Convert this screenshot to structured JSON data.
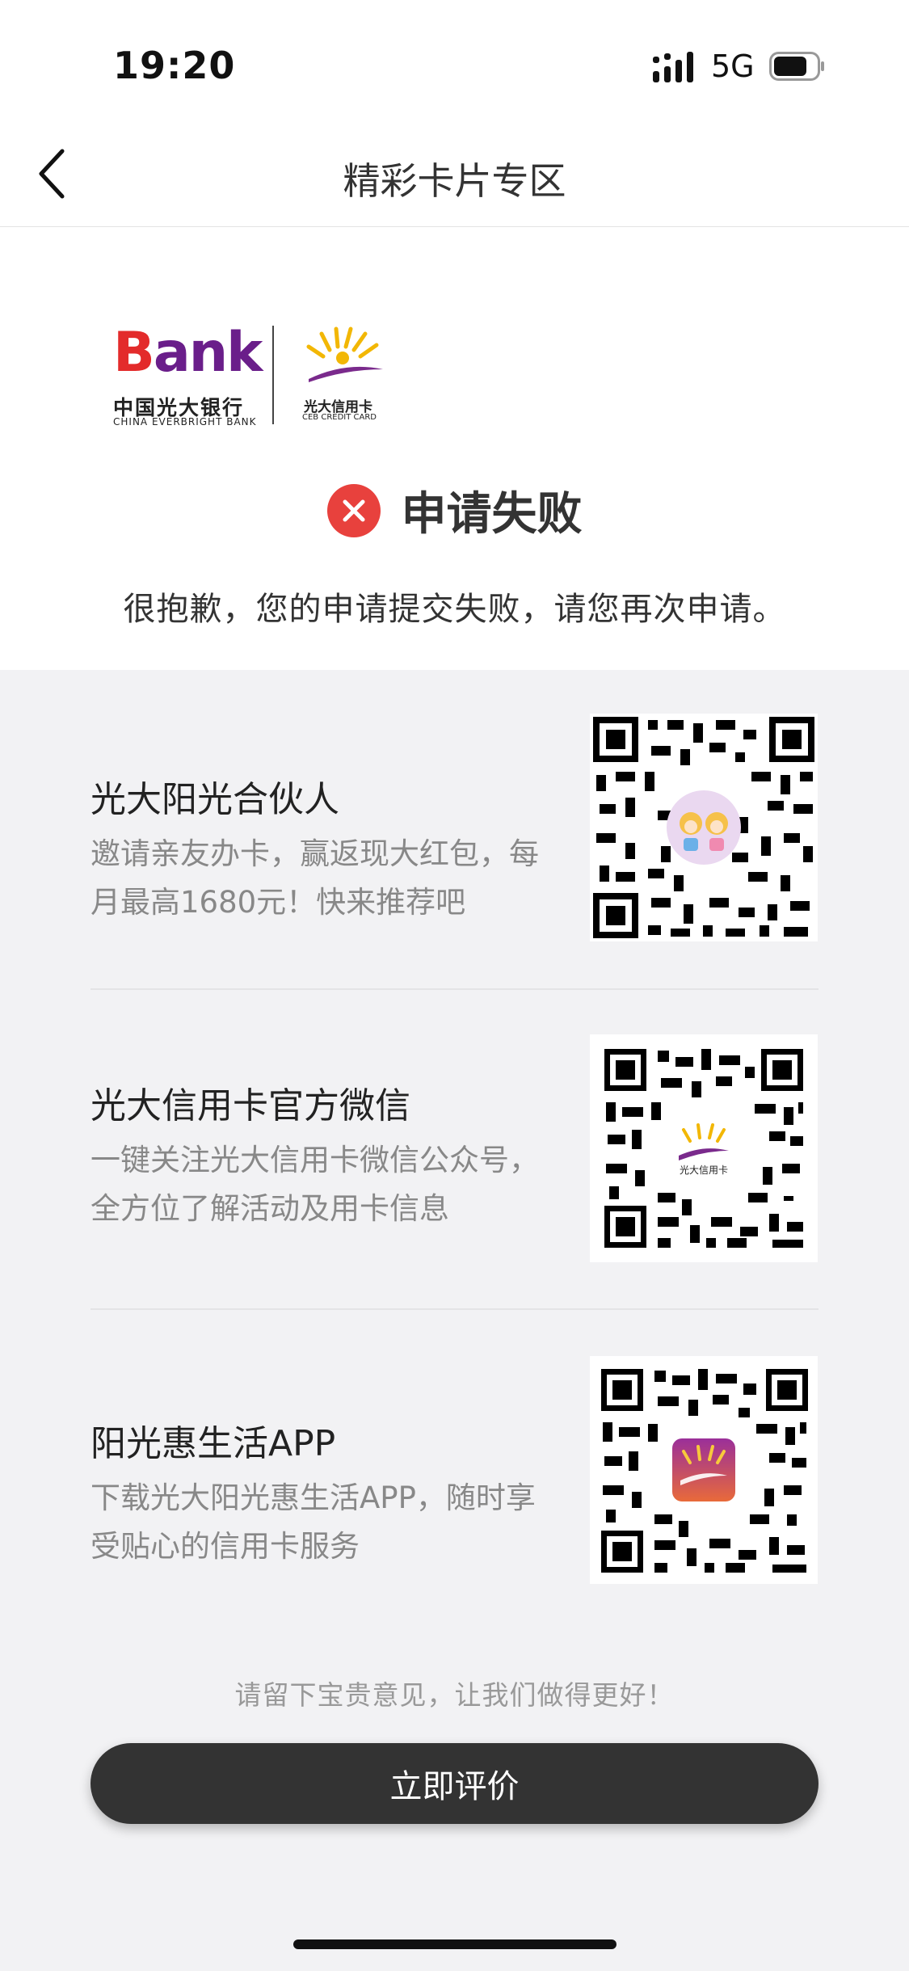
{
  "status_bar": {
    "time": "19:20",
    "network": "5G"
  },
  "nav": {
    "title": "精彩卡片专区",
    "back_icon": "chevron-left-icon"
  },
  "logos": {
    "bank_word_b": "B",
    "bank_word_rest": "ank",
    "bank_cn": "中国光大银行",
    "bank_en": "CHINA EVERBRIGHT BANK",
    "ceb_cn": "光大信用卡",
    "ceb_en": "CEB CREDIT CARD"
  },
  "result": {
    "icon": "close-circle-icon",
    "title": "申请失败",
    "message": "很抱歉，您的申请提交失败，请您再次申请。"
  },
  "promos": [
    {
      "title": "光大阳光合伙人",
      "desc": "邀请亲友办卡，赢返现大红包，每月最高1680元！快来推荐吧",
      "qr_icon": "qr-code-icon"
    },
    {
      "title": "光大信用卡官方微信",
      "desc": "一键关注光大信用卡微信公众号，全方位了解活动及用卡信息",
      "qr_icon": "qr-code-icon",
      "qr_center_text": "光大信用卡"
    },
    {
      "title": "阳光惠生活APP",
      "desc": "下载光大阳光惠生活APP，随时享受贴心的信用卡服务",
      "qr_icon": "qr-code-icon"
    }
  ],
  "feedback": {
    "hint": "请留下宝贵意见，让我们做得更好！",
    "button": "立即评价"
  },
  "colors": {
    "fail_red": "#e8413d",
    "button_dark": "#333333",
    "brand_purple": "#6a1e8a",
    "brand_red": "#e32b2b"
  }
}
